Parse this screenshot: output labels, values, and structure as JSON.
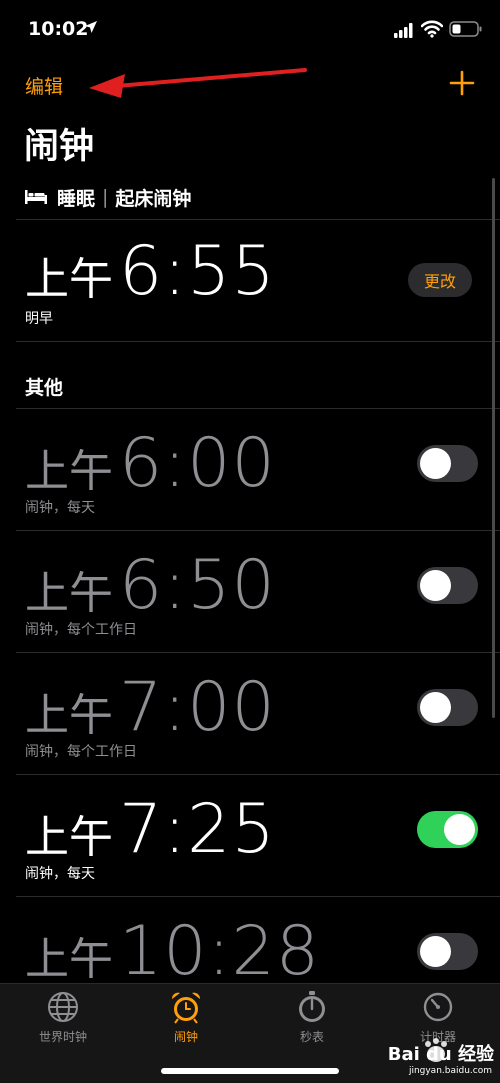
{
  "status_bar": {
    "time": "10:02"
  },
  "nav": {
    "edit_label": "编辑",
    "title": "闹钟"
  },
  "sleep": {
    "label": "睡眠",
    "separator": "|",
    "sub_label": "起床闹钟",
    "alarm": {
      "ampm": "上午",
      "time": "6:55",
      "subtitle": "明早",
      "change_label": "更改"
    }
  },
  "others": {
    "label": "其他",
    "alarms": [
      {
        "ampm": "上午",
        "time": "6:00",
        "subtitle": "闹钟，每天",
        "enabled": false
      },
      {
        "ampm": "上午",
        "time": "6:50",
        "subtitle": "闹钟，每个工作日",
        "enabled": false
      },
      {
        "ampm": "上午",
        "time": "7:00",
        "subtitle": "闹钟，每个工作日",
        "enabled": false
      },
      {
        "ampm": "上午",
        "time": "7:25",
        "subtitle": "闹钟，每天",
        "enabled": true
      },
      {
        "ampm": "上午",
        "time": "10:28",
        "subtitle": "",
        "enabled": false
      }
    ]
  },
  "tab_bar": {
    "tabs": [
      {
        "label": "世界时钟",
        "icon": "globe-icon"
      },
      {
        "label": "闹钟",
        "icon": "alarm-clock-icon",
        "active": true
      },
      {
        "label": "秒表",
        "icon": "stopwatch-icon"
      },
      {
        "label": "计时器",
        "icon": "timer-icon"
      }
    ]
  },
  "watermark": {
    "text": "Bai du 经验",
    "url": "jingyan.baidu.com"
  },
  "colors": {
    "accent": "#ff9f0a",
    "toggle_on": "#30d158",
    "toggle_off": "#39393d",
    "annotation_arrow": "#e02020"
  }
}
